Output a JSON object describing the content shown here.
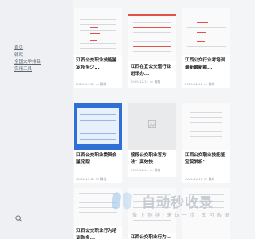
{
  "sidebar": {
    "links": [
      "首页",
      "赣戏",
      "全国大学排名",
      "实用工具"
    ]
  },
  "cards": [
    {
      "title": "江西公交职业技能鉴定所多少...",
      "date": "2025-12-11",
      "category": "赣戏"
    },
    {
      "title": "江西在宜公交道行业进举办...",
      "date": "2025-12-11",
      "category": "赣戏"
    },
    {
      "title": "江西公交行业考培训最新最新赣...",
      "date": "2025-12-11",
      "category": "赣戏"
    },
    {
      "title": "江西公交职业委员会鉴定院...",
      "date": "2025-12-11",
      "category": "赣戏"
    },
    {
      "title": "接段公交职业答方法：高效快...",
      "date": "2025-12-11",
      "category": "赣戏"
    },
    {
      "title": "江西公交职业技能鉴定院发析：...",
      "date": "2025-12-11",
      "category": "赣戏"
    },
    {
      "title": "江西公交职业行为培训防务...",
      "date": "",
      "category": ""
    },
    {
      "title": "江西公交职业行为...",
      "date": "",
      "category": ""
    }
  ],
  "watermark": {
    "title": "自动秒收录",
    "subtitle": "放 上 链 接  · 来 访 一 次 · 即 可 收 录"
  },
  "colors": {
    "sidebar_bg": "#eef0f3",
    "accent_red": "#e0534a",
    "accent_blue": "#2f6fd6"
  }
}
